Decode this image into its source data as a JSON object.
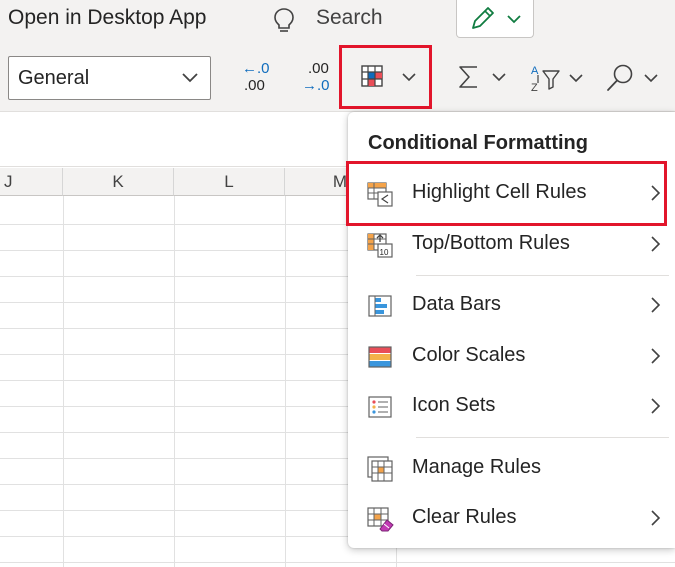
{
  "topbar": {
    "open_desktop_label": "Open in Desktop App",
    "search_label": "Search",
    "icons": [
      "lightbulb-icon",
      "pencil-icon",
      "chevron-down-icon"
    ]
  },
  "ribbon": {
    "number_format_value": "General",
    "decrease_decimal": {
      "top": "←.0",
      "bottom": ".00"
    },
    "increase_decimal": {
      "top": ".00",
      "bottom": "→.0"
    },
    "icons": [
      "conditional-formatting-icon",
      "sum-icon",
      "sort-filter-icon",
      "find-icon"
    ]
  },
  "grid": {
    "columns": [
      "J",
      "K",
      "L",
      "M"
    ]
  },
  "menu": {
    "title": "Conditional Formatting",
    "items": [
      {
        "label": "Highlight Cell Rules",
        "icon": "highlight-cell-rules-icon",
        "submenu": true
      },
      {
        "label": "Top/Bottom Rules",
        "icon": "top-bottom-rules-icon",
        "submenu": true
      },
      {
        "label": "Data Bars",
        "icon": "data-bars-icon",
        "submenu": true
      },
      {
        "label": "Color Scales",
        "icon": "color-scales-icon",
        "submenu": true
      },
      {
        "label": "Icon Sets",
        "icon": "icon-sets-icon",
        "submenu": true
      },
      {
        "label": "Manage Rules",
        "icon": "manage-rules-icon",
        "submenu": false
      },
      {
        "label": "Clear Rules",
        "icon": "clear-rules-icon",
        "submenu": true
      }
    ]
  },
  "colors": {
    "highlight_border": "#e2152b",
    "pencil_green": "#107c41",
    "accent_blue": "#0f6cbd"
  }
}
